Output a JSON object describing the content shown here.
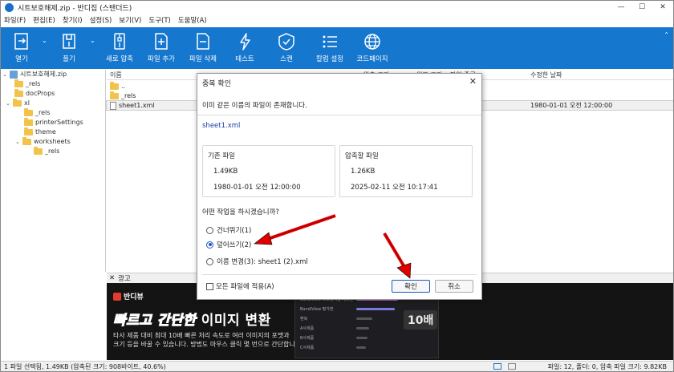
{
  "window": {
    "title": "시트보호해제.zip - 반디집 (스탠더드)",
    "controls": {
      "minimize": "—",
      "maximize": "☐",
      "close": "✕"
    }
  },
  "menu": [
    "파일(F)",
    "편집(E)",
    "찾기(I)",
    "설정(S)",
    "보기(V)",
    "도구(T)",
    "도움말(A)"
  ],
  "toolbar": {
    "items": [
      {
        "label": "열기",
        "icon": "open-icon"
      },
      {
        "label": "풀기",
        "icon": "extract-icon"
      },
      {
        "label": "새로 압축",
        "icon": "new-archive-icon"
      },
      {
        "label": "파일 추가",
        "icon": "add-file-icon"
      },
      {
        "label": "파일 삭제",
        "icon": "delete-file-icon"
      },
      {
        "label": "테스트",
        "icon": "test-icon"
      },
      {
        "label": "스캔",
        "icon": "scan-icon"
      },
      {
        "label": "칼럼 설정",
        "icon": "column-settings-icon"
      },
      {
        "label": "코드페이지",
        "icon": "codepage-icon"
      }
    ],
    "dropdown_glyph": "⌄",
    "collapse_glyph": "⌃",
    "color": "#1677cf"
  },
  "tree": [
    {
      "label": "시트보호해제.zip",
      "type": "zip",
      "expander": "⌄"
    },
    {
      "label": "_rels",
      "type": "folder",
      "expander": ""
    },
    {
      "label": "docProps",
      "type": "folder",
      "expander": ""
    },
    {
      "label": "xl",
      "type": "folder",
      "expander": "⌄"
    },
    {
      "label": "_rels",
      "type": "folder",
      "expander": ""
    },
    {
      "label": "printerSettings",
      "type": "folder",
      "expander": ""
    },
    {
      "label": "theme",
      "type": "folder",
      "expander": ""
    },
    {
      "label": "worksheets",
      "type": "folder",
      "expander": "⌄"
    },
    {
      "label": "_rels",
      "type": "folder",
      "expander": ""
    }
  ],
  "filelist": {
    "columns": {
      "name": "이름",
      "compressed": "압축 크기",
      "original": "원본 크기",
      "type": "파일 종류",
      "modified": "수정한 날짜"
    },
    "rows": [
      {
        "name": "..",
        "kind": "folder",
        "modified": ""
      },
      {
        "name": "_rels",
        "kind": "folder",
        "modified": ""
      },
      {
        "name": "sheet1.xml",
        "kind": "file",
        "modified": "1980-01-01 오전 12:00:00"
      }
    ]
  },
  "ad": {
    "header": "광고",
    "close": "✕",
    "brand": "반디뷰",
    "headline_italic": "빠르고 간단한",
    "headline_bold": "이미지 변환",
    "desc1": "타사 제품 대비 최대 10배 빠른 처리 속도로 여러 이미지의 포맷과",
    "desc2": "크기 등을 바꿀 수 있습니다. 방법도 마우스 클릭 몇 번으로 간단합니다.",
    "mock_rows": [
      "BandiView 프로페셔널 에디션",
      "BandiView 평가판",
      "펜북",
      "A사제품",
      "B사제품",
      "C사제품"
    ],
    "badge": "10배"
  },
  "status": {
    "left": "1 파일 선택됨, 1.49KB (압축된 크기: 908바이트, 40.6%)",
    "right": "파일: 12, 폴더: 0, 압축 파일 크기: 9.82KB"
  },
  "dialog": {
    "title": "중복 확인",
    "close": "✕",
    "message": "이미 같은 이름의 파일이 존재합니다.",
    "filename": "sheet1.xml",
    "existing": {
      "title": "기존 파일",
      "size": "1.49KB",
      "date": "1980-01-01 오전 12:00:00"
    },
    "incoming": {
      "title": "압축할 파일",
      "size": "1.26KB",
      "date": "2025-02-11 오전 10:17:41"
    },
    "question": "어떤 작업을 하시겠습니까?",
    "options": [
      {
        "label": "건너뛰기(1)",
        "selected": false
      },
      {
        "label": "덮어쓰기(2)",
        "selected": true
      },
      {
        "label": "이름 변경(3): sheet1 (2).xml",
        "selected": false
      }
    ],
    "apply_all": "모든 파일에 적용(A)",
    "ok": "확인",
    "cancel": "취소"
  },
  "annotation_color": "#e00000"
}
